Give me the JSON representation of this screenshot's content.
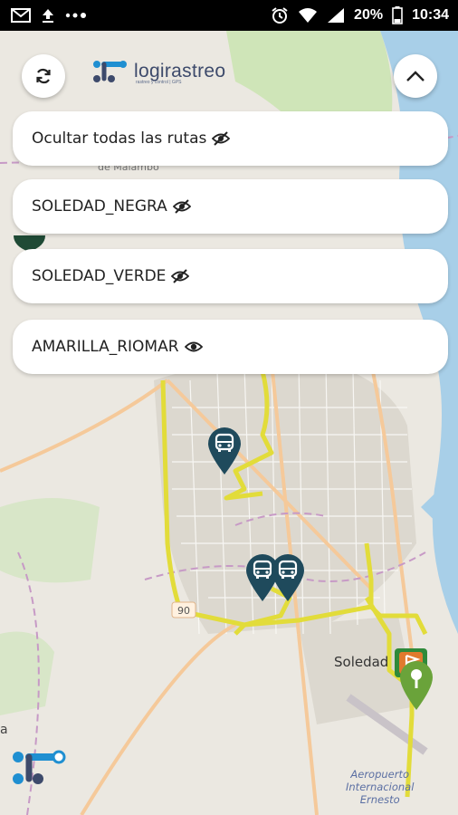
{
  "status_bar": {
    "icons_left": [
      "gmail-icon",
      "upload-icon",
      "more-dots-icon"
    ],
    "icons_right": [
      "alarm-icon",
      "wifi-icon",
      "signal-icon",
      "battery-icon"
    ],
    "battery_percent": "20%",
    "time": "10:34"
  },
  "header": {
    "logo_text": "logirastreo",
    "logo_tagline": "rastreo y control | GPS",
    "refresh_icon": "refresh-icon",
    "collapse_icon": "chevron-up-icon"
  },
  "routes": {
    "hide_all": {
      "label": "Ocultar todas las rutas",
      "icon": "eye-off-icon"
    },
    "items": [
      {
        "label": "SOLEDAD_NEGRA",
        "icon": "eye-off-icon",
        "visible": false
      },
      {
        "label": "SOLEDAD_VERDE",
        "icon": "eye-off-icon",
        "visible": false
      },
      {
        "label": "AMARILLA_RIOMAR",
        "icon": "eye-icon",
        "visible": true
      }
    ]
  },
  "map": {
    "labels": {
      "city": "Soledad",
      "road_shield": "90",
      "partial_place": "de Malambo",
      "edge_letter": "a",
      "airport_line1": "Aeropuerto",
      "airport_line2": "Internacional",
      "airport_line3": "Ernesto"
    },
    "markers": [
      {
        "type": "bus",
        "icon": "bus-icon",
        "color": "#1f4a5c"
      },
      {
        "type": "bus",
        "icon": "bus-icon",
        "color": "#1f4a5c"
      },
      {
        "type": "bus",
        "icon": "bus-icon",
        "color": "#1f4a5c"
      },
      {
        "type": "stop",
        "icon": "location-pin-icon",
        "color": "#6aa33a"
      },
      {
        "type": "stop",
        "icon": "flag-icon",
        "color": "#e07a2e"
      }
    ],
    "colors": {
      "route": "#e2dc3a",
      "water": "#a8cfe8",
      "park": "#cfe5b8",
      "road": "#f5c99a"
    }
  },
  "brand_mark": "logirastreo-mark-icon"
}
